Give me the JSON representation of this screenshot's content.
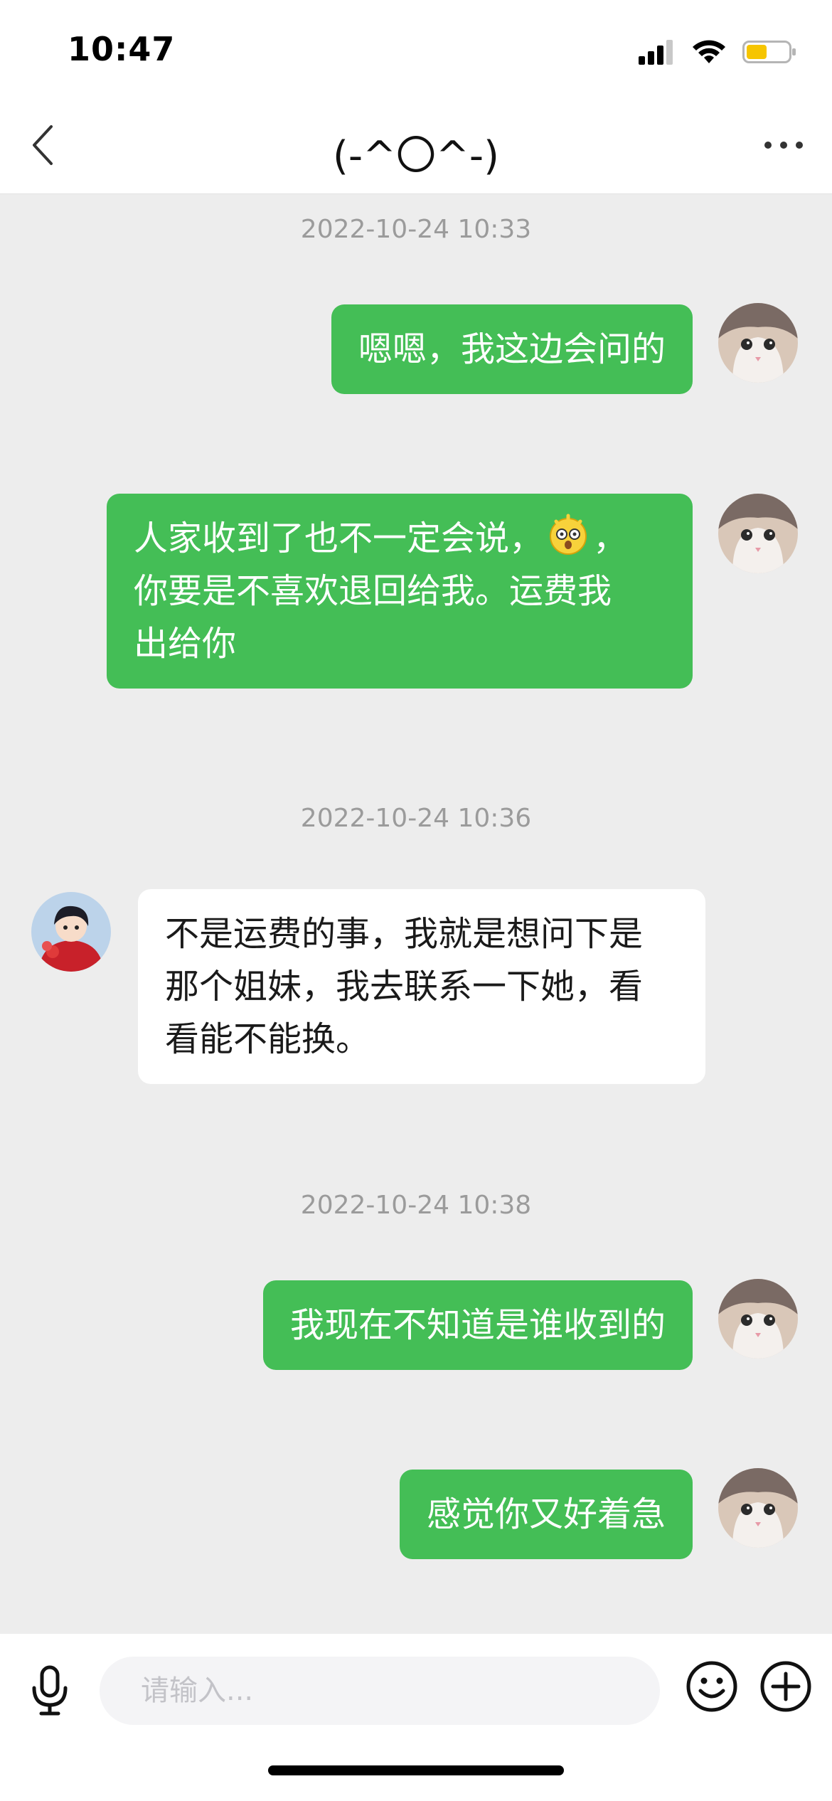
{
  "status_bar": {
    "time": "10:47",
    "battery_color": "#f6c500"
  },
  "nav": {
    "title": "(-^〇^-)",
    "back_icon": "chevron-left-icon",
    "more_icon": "more-dots-icon"
  },
  "colors": {
    "sent_bubble": "#44be56",
    "received_bubble": "#ffffff",
    "chat_background": "#ededed"
  },
  "messages": [
    {
      "type": "timestamp",
      "text": "2022-10-24 10:33"
    },
    {
      "type": "sent",
      "text": "嗯嗯，我这边会问的"
    },
    {
      "type": "sent",
      "lines": [
        "人家收到了也不一定会说，",
        "，",
        "你要是不喜欢退回给我。运费我",
        "出给你"
      ],
      "emoji": "dizzy-face-emoji"
    },
    {
      "type": "timestamp",
      "text": "2022-10-24 10:36"
    },
    {
      "type": "received",
      "lines": [
        "不是运费的事，我就是想问下是",
        "那个姐妹，我去联系一下她，看",
        "看能不能换。"
      ]
    },
    {
      "type": "timestamp",
      "text": "2022-10-24 10:38"
    },
    {
      "type": "sent",
      "text": "我现在不知道是谁收到的"
    },
    {
      "type": "sent",
      "text": "感觉你又好着急"
    }
  ],
  "composer": {
    "placeholder": "请输入...",
    "value": "",
    "mic_icon": "microphone-icon",
    "emoji_icon": "smiley-icon",
    "plus_icon": "plus-circle-icon"
  }
}
